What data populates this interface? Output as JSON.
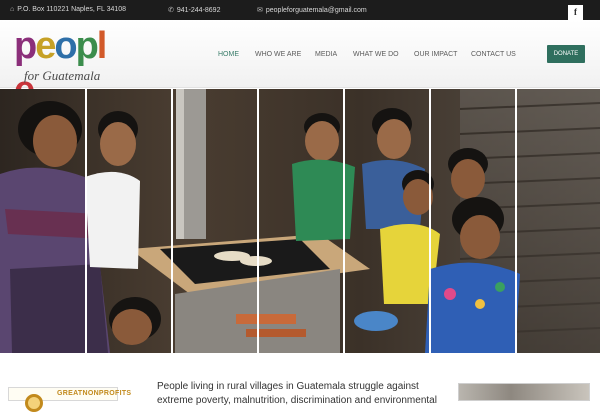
{
  "topbar": {
    "address": "P.O. Box 110221 Naples, FL 34108",
    "phone": "941-244-8692",
    "email": "peopleforguatemala@gmail.com",
    "social_label": "f"
  },
  "header": {
    "logo_word": "people",
    "logo_sub": "for Guatemala",
    "logo_colors": [
      "#8b2f7a",
      "#c6a126",
      "#2e6fa8",
      "#3b8d4c",
      "#d25a2a",
      "#c8343a"
    ],
    "nav": [
      {
        "label": "HOME",
        "active": true
      },
      {
        "label": "WHO WE ARE",
        "active": false
      },
      {
        "label": "MEDIA",
        "active": false
      },
      {
        "label": "WHAT WE DO",
        "active": false
      },
      {
        "label": "OUR IMPACT",
        "active": false
      },
      {
        "label": "CONTACT US",
        "active": false
      }
    ],
    "donate_label": "DONATE",
    "accent_color": "#2f6f5e"
  },
  "hero": {
    "panel_count": 7
  },
  "content": {
    "badge_label": "GREATNONPROFITS",
    "intro_text": "People living in rural villages in Guatemala struggle against extreme poverty, malnutrition, discrimination and environmental"
  }
}
